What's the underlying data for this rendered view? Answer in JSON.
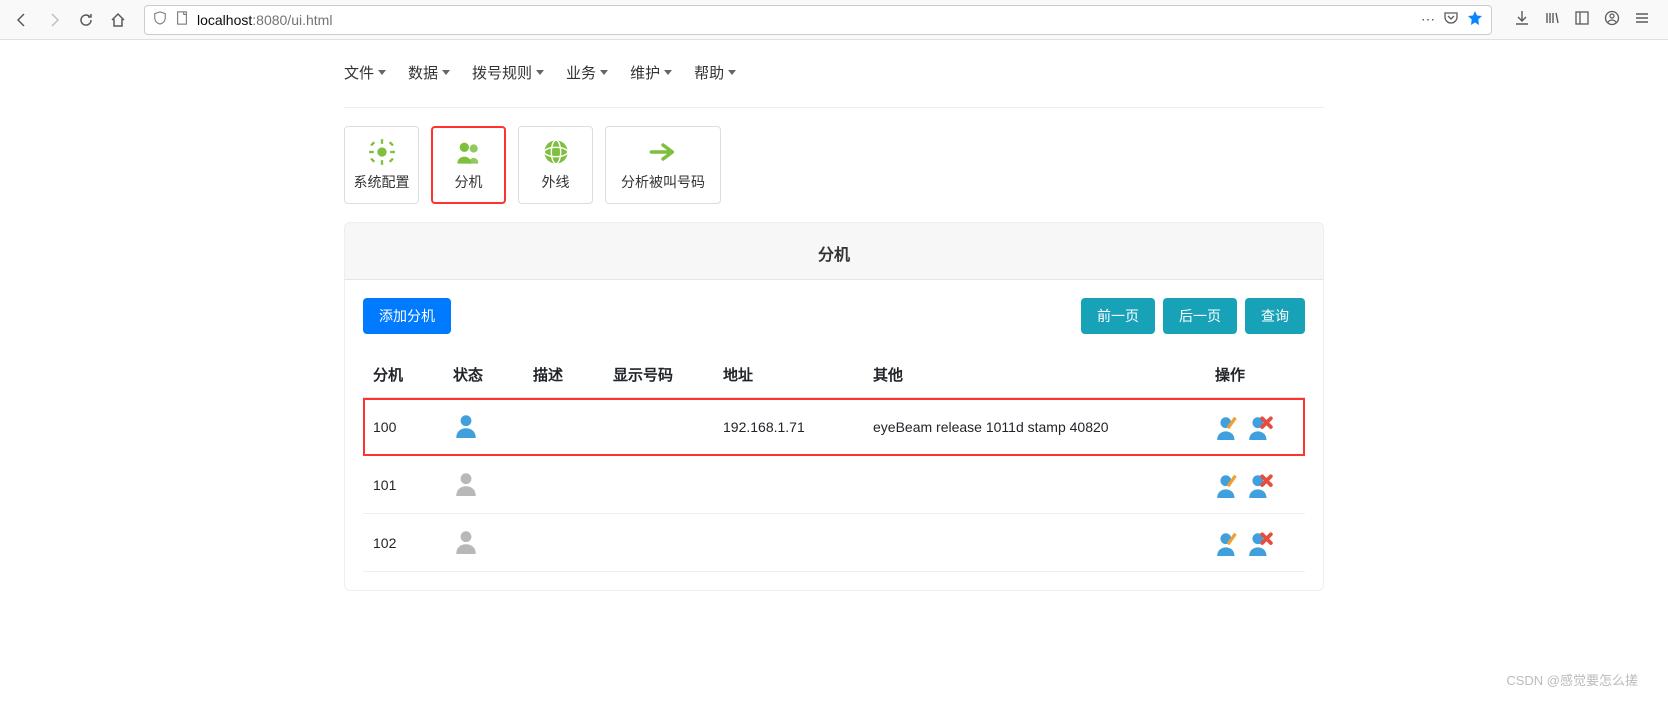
{
  "browser": {
    "url_host": "localhost",
    "url_port_path": ":8080/ui.html"
  },
  "menu": {
    "items": [
      "文件",
      "数据",
      "拨号规则",
      "业务",
      "维护",
      "帮助"
    ]
  },
  "toolbar": {
    "items": [
      {
        "label": "系统配置",
        "icon": "gear-icon"
      },
      {
        "label": "分机",
        "icon": "users-icon",
        "selected": true
      },
      {
        "label": "外线",
        "icon": "globe-icon"
      },
      {
        "label": "分析被叫号码",
        "icon": "arrow-right-icon",
        "wide": true
      }
    ]
  },
  "panel": {
    "title": "分机",
    "add_button": "添加分机",
    "prev_button": "前一页",
    "next_button": "后一页",
    "query_button": "查询"
  },
  "table": {
    "headers": [
      "分机",
      "状态",
      "描述",
      "显示号码",
      "地址",
      "其他",
      "操作"
    ],
    "rows": [
      {
        "ext": "100",
        "status": "online",
        "desc": "",
        "display": "",
        "addr": "192.168.1.71",
        "other": "eyeBeam release 1011d stamp 40820",
        "highlighted": true
      },
      {
        "ext": "101",
        "status": "offline",
        "desc": "",
        "display": "",
        "addr": "",
        "other": "",
        "highlighted": false
      },
      {
        "ext": "102",
        "status": "offline",
        "desc": "",
        "display": "",
        "addr": "",
        "other": "",
        "highlighted": false
      }
    ]
  },
  "watermark": "CSDN @感觉要怎么搓"
}
